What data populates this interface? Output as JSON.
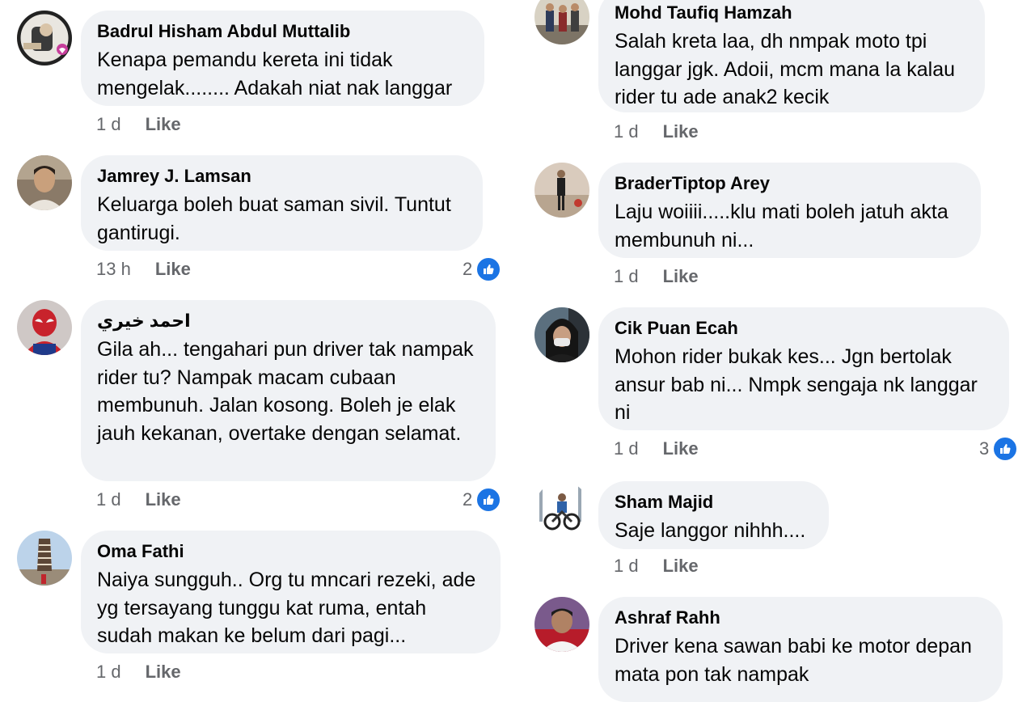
{
  "colors": {
    "bubble_bg": "#f0f2f5",
    "author_text": "#050505",
    "meta_text": "#65676b",
    "reaction_blue": "#1b74e4"
  },
  "comments_left": [
    {
      "author": "Badrul Hisham Abdul Muttalib",
      "text": "Kenapa pemandu kereta ini tidak mengelak........ Adakah niat nak langgar",
      "time": "1 d",
      "like_label": "Like",
      "avatar_icon": "vaccine-frame-avatar-icon"
    },
    {
      "author": "Jamrey J. Lamsan",
      "text": "Keluarga boleh buat saman sivil. Tuntut gantirugi.",
      "time": "13 h",
      "like_label": "Like",
      "reactions": "2",
      "avatar_icon": "person-photo-avatar-icon"
    },
    {
      "author": "احمد خيري",
      "text": "Gila ah... tengahari pun driver tak nampak rider tu? Nampak macam cubaan membunuh. Jalan kosong. Boleh je elak jauh kekanan, overtake dengan selamat.",
      "time": "1 d",
      "like_label": "Like",
      "reactions": "2",
      "avatar_icon": "spiderman-avatar-icon"
    },
    {
      "author": "Oma Fathi",
      "text": "Naiya sungguh.. Org tu mncari rezeki, ade yg tersayang tunggu kat ruma, entah sudah makan ke belum dari pagi...",
      "time": "1 d",
      "like_label": "Like",
      "avatar_icon": "leaning-tower-avatar-icon"
    }
  ],
  "comments_right": [
    {
      "author": "Mohd Taufiq Hamzah",
      "text": "Salah kreta laa, dh nmpak moto tpi langgar jgk. Adoii, mcm mana la kalau rider tu ade anak2 kecik",
      "time": "1 d",
      "like_label": "Like",
      "avatar_icon": "group-photo-avatar-icon"
    },
    {
      "author": "BraderTiptop Arey",
      "text": "Laju woiiii.....klu mati boleh jatuh akta membunuh ni...",
      "time": "1 d",
      "like_label": "Like",
      "avatar_icon": "standing-man-avatar-icon"
    },
    {
      "author": "Cik Puan Ecah",
      "text": "Mohon rider bukak kes...  Jgn bertolak ansur bab ni... Nmpk sengaja nk langgar ni",
      "time": "1 d",
      "like_label": "Like",
      "reactions": "3",
      "avatar_icon": "masked-woman-avatar-icon"
    },
    {
      "author": "Sham Majid",
      "text": "Saje langgor nihhh....",
      "time": "1 d",
      "like_label": "Like",
      "avatar_icon": "cyclist-avatar-icon"
    },
    {
      "author": "Ashraf Rahh",
      "text": "Driver kena sawan babi ke motor depan mata pon tak nampak",
      "avatar_icon": "man-portrait-avatar-icon"
    }
  ]
}
